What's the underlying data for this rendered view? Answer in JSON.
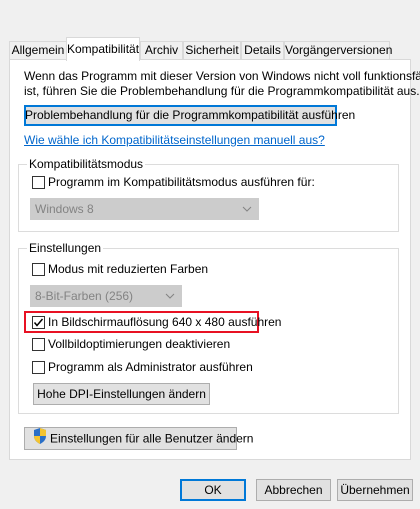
{
  "tabs": [
    "Allgemein",
    "Kompatibilität",
    "Archiv",
    "Sicherheit",
    "Details",
    "Vorgängerversionen"
  ],
  "active_tab": "Kompatibilität",
  "intro": {
    "line1": "Wenn das Programm mit dieser Version von Windows nicht voll funktionsfähig",
    "line2": "ist, führen Sie die Problembehandlung für die Programmkompatibilität aus."
  },
  "troubleshoot_button": "Problembehandlung für die Programmkompatibilität ausführen",
  "manual_link": "Wie wähle ich Kompatibilitätseinstellungen manuell aus?",
  "compat_mode": {
    "title": "Kompatibilitätsmodus",
    "checkbox_label": "Programm im Kompatibilitätsmodus ausführen für:",
    "checked": false,
    "os_select": "Windows 8"
  },
  "settings": {
    "title": "Einstellungen",
    "reduced_colors_label": "Modus mit reduzierten Farben",
    "reduced_colors_checked": false,
    "color_select": "8-Bit-Farben (256)",
    "resolution_label": "In Bildschirmauflösung 640 x 480 ausführen",
    "resolution_checked": true,
    "fullscreen_opt_label": "Vollbildoptimierungen deaktivieren",
    "fullscreen_opt_checked": false,
    "admin_label": "Programm als Administrator ausführen",
    "admin_checked": false,
    "dpi_button": "Hohe DPI-Einstellungen ändern"
  },
  "all_users_button": "Einstellungen für alle Benutzer ändern",
  "footer": {
    "ok": "OK",
    "cancel": "Abbrechen",
    "apply": "Übernehmen"
  },
  "colors": {
    "highlight": "#e81123",
    "link": "#0066cc",
    "accent": "#0078d7"
  }
}
